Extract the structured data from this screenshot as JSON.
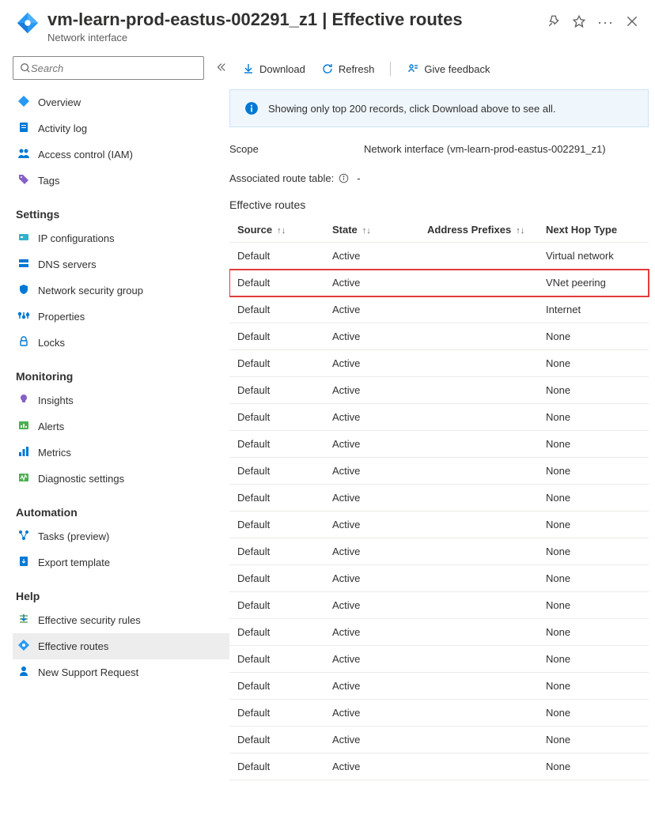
{
  "header": {
    "title_prefix": "vm-learn-prod-eastus-002291_z1",
    "title_suffix": " | Effective routes",
    "subtitle": "Network interface"
  },
  "search": {
    "placeholder": "Search"
  },
  "nav": {
    "top": [
      {
        "key": "overview",
        "label": "Overview"
      },
      {
        "key": "activity-log",
        "label": "Activity log"
      },
      {
        "key": "access-control",
        "label": "Access control (IAM)"
      },
      {
        "key": "tags",
        "label": "Tags"
      }
    ],
    "settings_label": "Settings",
    "settings": [
      {
        "key": "ip-configurations",
        "label": "IP configurations"
      },
      {
        "key": "dns-servers",
        "label": "DNS servers"
      },
      {
        "key": "nsg",
        "label": "Network security group"
      },
      {
        "key": "properties",
        "label": "Properties"
      },
      {
        "key": "locks",
        "label": "Locks"
      }
    ],
    "monitoring_label": "Monitoring",
    "monitoring": [
      {
        "key": "insights",
        "label": "Insights"
      },
      {
        "key": "alerts",
        "label": "Alerts"
      },
      {
        "key": "metrics",
        "label": "Metrics"
      },
      {
        "key": "diagnostic",
        "label": "Diagnostic settings"
      }
    ],
    "automation_label": "Automation",
    "automation": [
      {
        "key": "tasks",
        "label": "Tasks (preview)"
      },
      {
        "key": "export-template",
        "label": "Export template"
      }
    ],
    "help_label": "Help",
    "help": [
      {
        "key": "effective-security-rules",
        "label": "Effective security rules"
      },
      {
        "key": "effective-routes",
        "label": "Effective routes",
        "active": true
      },
      {
        "key": "new-support-request",
        "label": "New Support Request"
      }
    ]
  },
  "toolbar": {
    "download": "Download",
    "refresh": "Refresh",
    "feedback": "Give feedback"
  },
  "banner": {
    "text": "Showing only top 200 records, click Download above to see all."
  },
  "scope": {
    "label": "Scope",
    "value": "Network interface (vm-learn-prod-eastus-002291_z1)"
  },
  "assoc": {
    "label": "Associated route table:",
    "value": "-"
  },
  "routes": {
    "title": "Effective routes",
    "columns": {
      "source": "Source",
      "state": "State",
      "prefixes": "Address Prefixes",
      "nexthop": "Next Hop Type"
    },
    "rows": [
      {
        "source": "Default",
        "state": "Active",
        "prefix": "",
        "nexthop": "Virtual network",
        "highlight": false
      },
      {
        "source": "Default",
        "state": "Active",
        "prefix": "",
        "nexthop": "VNet peering",
        "highlight": true
      },
      {
        "source": "Default",
        "state": "Active",
        "prefix": "",
        "nexthop": "Internet",
        "highlight": false
      },
      {
        "source": "Default",
        "state": "Active",
        "prefix": "",
        "nexthop": "None",
        "highlight": false
      },
      {
        "source": "Default",
        "state": "Active",
        "prefix": "",
        "nexthop": "None",
        "highlight": false
      },
      {
        "source": "Default",
        "state": "Active",
        "prefix": "",
        "nexthop": "None",
        "highlight": false
      },
      {
        "source": "Default",
        "state": "Active",
        "prefix": "",
        "nexthop": "None",
        "highlight": false
      },
      {
        "source": "Default",
        "state": "Active",
        "prefix": "",
        "nexthop": "None",
        "highlight": false
      },
      {
        "source": "Default",
        "state": "Active",
        "prefix": "",
        "nexthop": "None",
        "highlight": false
      },
      {
        "source": "Default",
        "state": "Active",
        "prefix": "",
        "nexthop": "None",
        "highlight": false
      },
      {
        "source": "Default",
        "state": "Active",
        "prefix": "",
        "nexthop": "None",
        "highlight": false
      },
      {
        "source": "Default",
        "state": "Active",
        "prefix": "",
        "nexthop": "None",
        "highlight": false
      },
      {
        "source": "Default",
        "state": "Active",
        "prefix": "",
        "nexthop": "None",
        "highlight": false
      },
      {
        "source": "Default",
        "state": "Active",
        "prefix": "",
        "nexthop": "None",
        "highlight": false
      },
      {
        "source": "Default",
        "state": "Active",
        "prefix": "",
        "nexthop": "None",
        "highlight": false
      },
      {
        "source": "Default",
        "state": "Active",
        "prefix": "",
        "nexthop": "None",
        "highlight": false
      },
      {
        "source": "Default",
        "state": "Active",
        "prefix": "",
        "nexthop": "None",
        "highlight": false
      },
      {
        "source": "Default",
        "state": "Active",
        "prefix": "",
        "nexthop": "None",
        "highlight": false
      },
      {
        "source": "Default",
        "state": "Active",
        "prefix": "",
        "nexthop": "None",
        "highlight": false
      },
      {
        "source": "Default",
        "state": "Active",
        "prefix": "",
        "nexthop": "None",
        "highlight": false
      }
    ]
  }
}
